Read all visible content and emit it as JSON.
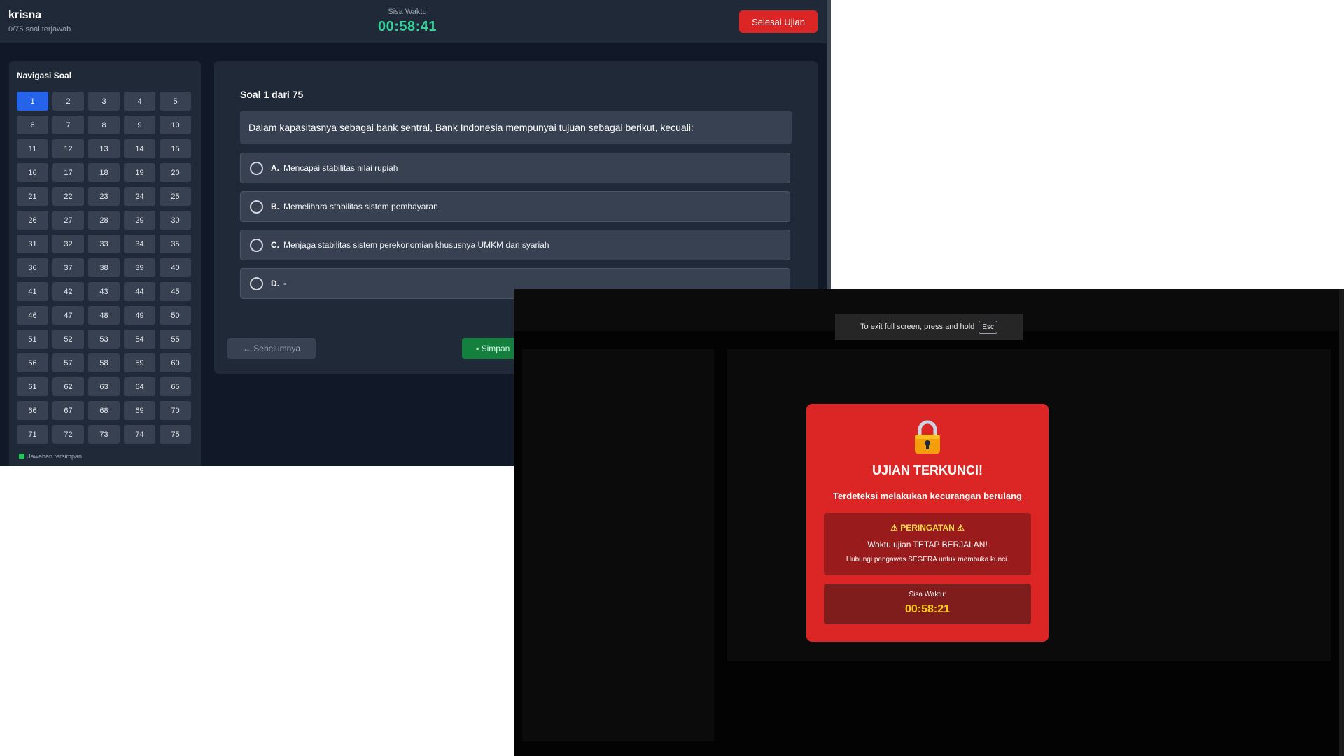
{
  "header": {
    "user_name": "krisna",
    "progress": "0/75 soal terjawab",
    "timer_label": "Sisa Waktu",
    "timer_value": "00:58:41",
    "finish_button": "Selesai Ujian",
    "finish_color": "#dc2626"
  },
  "nav": {
    "title": "Navigasi Soal",
    "active": 1,
    "active_color": "#2563eb",
    "items": [
      "1",
      "2",
      "3",
      "4",
      "5",
      "6",
      "7",
      "8",
      "9",
      "10",
      "11",
      "12",
      "13",
      "14",
      "15",
      "16",
      "17",
      "18",
      "19",
      "20",
      "21",
      "22",
      "23",
      "24",
      "25",
      "26",
      "27",
      "28",
      "29",
      "30",
      "31",
      "32",
      "33",
      "34",
      "35",
      "36",
      "37",
      "38",
      "39",
      "40",
      "41",
      "42",
      "43",
      "44",
      "45",
      "46",
      "47",
      "48",
      "49",
      "50",
      "51",
      "52",
      "53",
      "54",
      "55",
      "56",
      "57",
      "58",
      "59",
      "60",
      "61",
      "62",
      "63",
      "64",
      "65",
      "66",
      "67",
      "68",
      "69",
      "70",
      "71",
      "72",
      "73",
      "74",
      "75"
    ],
    "legend": "Jawaban tersimpan",
    "legend_color": "#22c55e"
  },
  "question": {
    "header": "Soal 1 dari 75",
    "text": "Dalam kapasitasnya sebagai bank sentral, Bank Indonesia mempunyai tujuan sebagai berikut, kecuali:",
    "options": [
      {
        "letter": "A.",
        "text": "Mencapai stabilitas nilai rupiah"
      },
      {
        "letter": "B.",
        "text": "Memelihara stabilitas sistem pembayaran"
      },
      {
        "letter": "C.",
        "text": "Menjaga stabilitas sistem perekonomian khususnya UMKM dan syariah"
      },
      {
        "letter": "D.",
        "text": "-"
      }
    ],
    "prev_button": "← Sebelumnya",
    "save_button": "Simpan",
    "save_icon": "save-icon"
  },
  "fullscreen_notice": {
    "text": "To exit full screen, press and hold",
    "key": "Esc"
  },
  "lock": {
    "icon": "lock-icon",
    "title": "UJIAN TERKUNCI!",
    "subtitle": "Terdeteksi melakukan kecurangan berulang",
    "warning_title": "⚠ PERINGATAN ⚠",
    "warning_line1": "Waktu ujian TETAP BERJALAN!",
    "warning_line2": "Hubungi pengawas SEGERA untuk membuka kunci.",
    "time_label": "Sisa Waktu:",
    "time_value": "00:58:21",
    "card_color": "#dc2626",
    "time_color": "#facc15"
  }
}
